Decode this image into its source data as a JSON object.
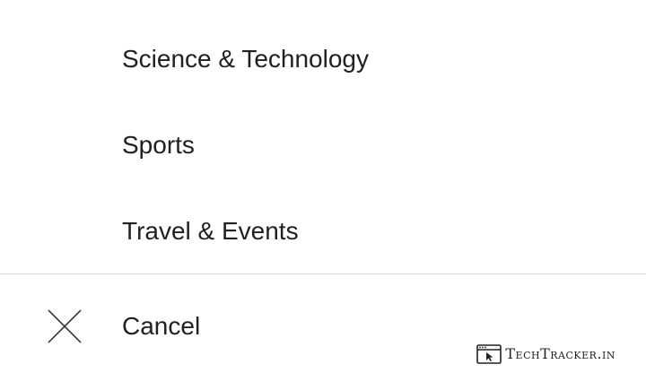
{
  "menu": {
    "items": [
      {
        "label": "Science & Technology"
      },
      {
        "label": "Sports"
      },
      {
        "label": "Travel & Events"
      }
    ]
  },
  "cancel": {
    "label": "Cancel",
    "icon": "close-icon"
  },
  "watermark": {
    "text": "TechTracker.in",
    "icon": "browser-cursor-icon"
  },
  "colors": {
    "text": "#212121",
    "divider": "#d6d6d6",
    "background": "#ffffff"
  }
}
